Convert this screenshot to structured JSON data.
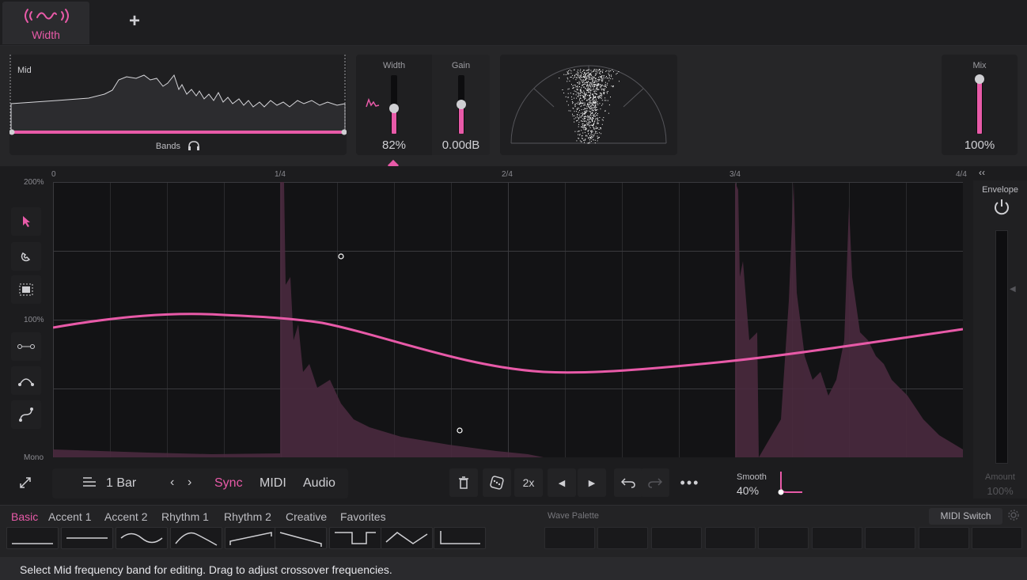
{
  "tabs": {
    "active_label": "Width",
    "add_label": "+"
  },
  "spectrum": {
    "band_label": "Mid",
    "bands_label": "Bands"
  },
  "width_module": {
    "title": "Width",
    "value": "82%",
    "level": 0.41
  },
  "gain_module": {
    "title": "Gain",
    "value": "0.00dB",
    "level": 0.5
  },
  "mix_module": {
    "title": "Mix",
    "value": "100%",
    "level": 1.0
  },
  "editor": {
    "ruler": [
      "0",
      "1/4",
      "2/4",
      "3/4",
      "4/4"
    ],
    "y_top": "200%",
    "y_mid": "100%",
    "y_bottom": "Mono"
  },
  "envelope": {
    "title": "Envelope",
    "amount_label": "Amount",
    "amount_value": "100%"
  },
  "transport": {
    "length": "1 Bar",
    "sync": "Sync",
    "midi": "MIDI",
    "audio": "Audio",
    "multiplier": "2x",
    "smooth_label": "Smooth",
    "smooth_value": "40%"
  },
  "presets": {
    "categories": [
      "Basic",
      "Accent 1",
      "Accent 2",
      "Rhythm 1",
      "Rhythm 2",
      "Creative",
      "Favorites"
    ],
    "wave_palette": "Wave Palette",
    "midi_switch": "MIDI Switch"
  },
  "status": "Select Mid frequency band for editing. Drag to adjust crossover frequencies.",
  "colors": {
    "accent": "#e85aa8",
    "background": "#1b1b1d",
    "panel": "#1f1f21"
  }
}
